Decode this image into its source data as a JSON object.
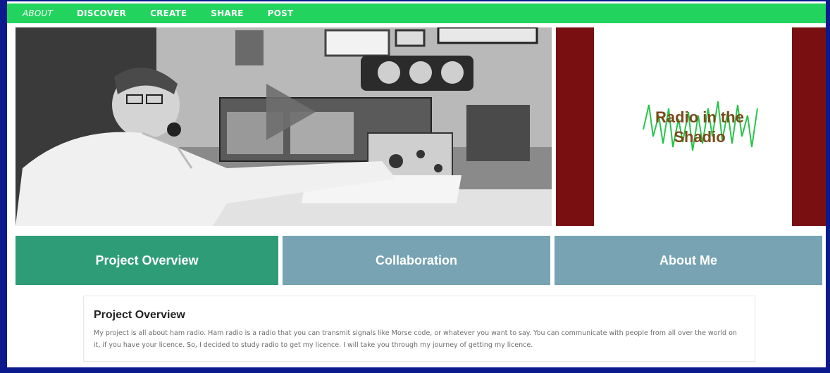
{
  "nav": {
    "items": [
      {
        "label": "ABOUT",
        "active": true
      },
      {
        "label": "DISCOVER"
      },
      {
        "label": "CREATE"
      },
      {
        "label": "SHARE"
      },
      {
        "label": "POST"
      }
    ]
  },
  "hero": {
    "logo_text_line1": "Radio in the",
    "logo_text_line2": "Shadio"
  },
  "tabs": [
    {
      "label": "Project Overview"
    },
    {
      "label": "Collaboration"
    },
    {
      "label": "About Me"
    }
  ],
  "content": {
    "title": "Project Overview",
    "body": "My project is all about ham radio. Ham radio is a radio that you can transmit signals like Morse code, or whatever you want to say. You can communicate with people from all over the world on it, if you have your licence. So, I decided to study radio to get my licence. I will take you through my journey of getting my licence."
  },
  "colors": {
    "background": "#0b1a8c",
    "nav": "#22d45e",
    "tab_active": "#2e9d77",
    "tab_inactive": "#77a3b2",
    "logo_panel": "#7a0f12"
  }
}
